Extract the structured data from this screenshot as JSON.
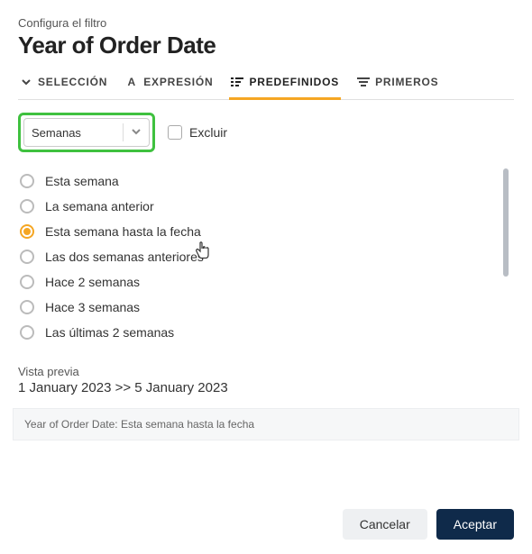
{
  "header": {
    "subtitle": "Configura el filtro",
    "title": "Year of Order Date"
  },
  "tabs": {
    "seleccion": "SELECCIÓN",
    "expresion": "EXPRESIÓN",
    "predefinidos": "PREDEFINIDOS",
    "primeros": "PRIMEROS"
  },
  "controls": {
    "dropdown_value": "Semanas",
    "exclude_label": "Excluir"
  },
  "options": [
    "Esta semana",
    "La semana anterior",
    "Esta semana hasta la fecha",
    "Las dos semanas anteriores",
    "Hace 2 semanas",
    "Hace 3 semanas",
    "Las últimas 2 semanas"
  ],
  "selected_index": 2,
  "preview": {
    "label": "Vista previa",
    "value": "1 January 2023 >> 5 January 2023"
  },
  "summary": "Year of Order Date: Esta semana hasta la fecha",
  "footer": {
    "cancel": "Cancelar",
    "accept": "Aceptar"
  }
}
